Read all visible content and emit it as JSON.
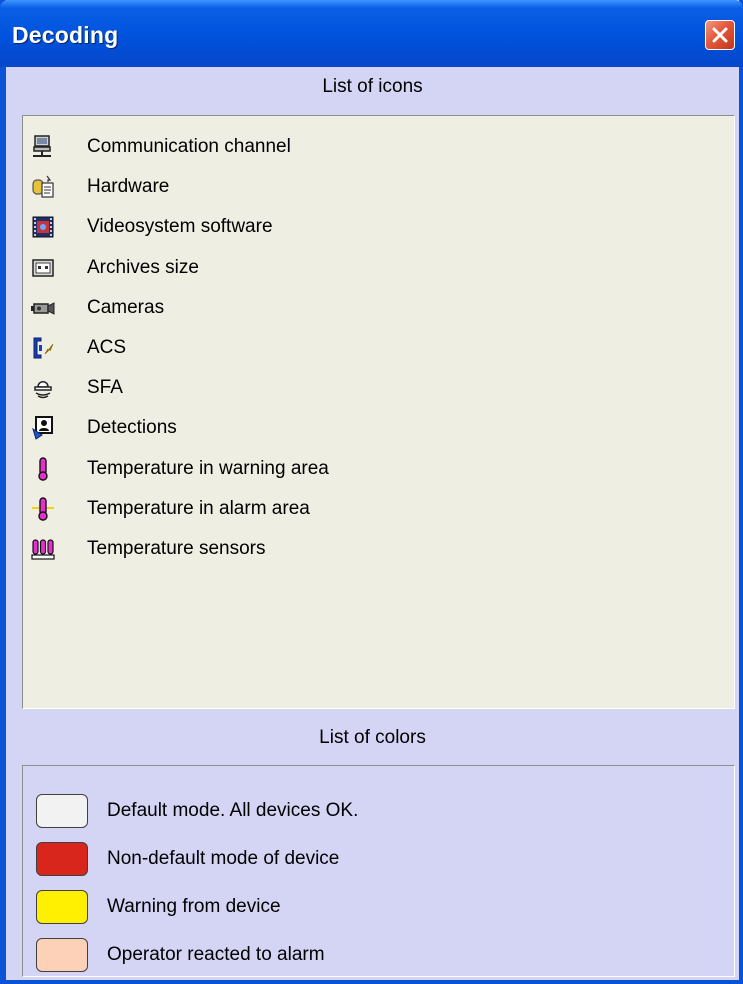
{
  "window": {
    "title": "Decoding"
  },
  "icons_section": {
    "header": "List of icons",
    "items": [
      {
        "label": "Communication channel",
        "icon": "computer-network-icon"
      },
      {
        "label": "Hardware",
        "icon": "hardware-icon"
      },
      {
        "label": "Videosystem software",
        "icon": "film-reel-icon"
      },
      {
        "label": "Archives size",
        "icon": "archive-drive-icon"
      },
      {
        "label": "Cameras",
        "icon": "camera-icon"
      },
      {
        "label": "ACS",
        "icon": "door-access-icon"
      },
      {
        "label": "SFA",
        "icon": "alarm-siren-icon"
      },
      {
        "label": "Detections",
        "icon": "detection-shield-icon"
      },
      {
        "label": "Temperature in warning area",
        "icon": "thermometer-warning-icon"
      },
      {
        "label": "Temperature in alarm area",
        "icon": "thermometer-alarm-icon"
      },
      {
        "label": "Temperature sensors",
        "icon": "temperature-sensors-icon"
      }
    ]
  },
  "colors_section": {
    "header": "List of colors",
    "items": [
      {
        "label": "Default mode. All devices OK.",
        "color": "#f2f2f2"
      },
      {
        "label": "Non-default mode of device",
        "color": "#d9261c"
      },
      {
        "label": "Warning from device",
        "color": "#ffef00"
      },
      {
        "label": "Operator reacted to alarm",
        "color": "#fdd0b8"
      }
    ]
  }
}
